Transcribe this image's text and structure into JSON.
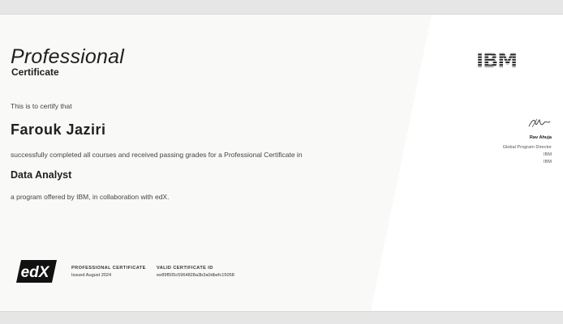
{
  "certificate": {
    "title": "Professional",
    "subtitle": "Certificate",
    "certify_text": "This is to certify that",
    "recipient_name": "Farouk Jaziri",
    "completion_text": "successfully completed all courses and received passing grades for a Professional Certificate in",
    "program_name": "Data Analyst",
    "offered_text": "a program offered by IBM, in collaboration with edX."
  },
  "footer": {
    "type_label": "PROFESSIONAL CERTIFICATE",
    "issued_text": "Issued August 2024",
    "id_label": "VALID CERTIFICATE ID",
    "certificate_id": "ee89f505c5964828a3b3a0dbefc15058"
  },
  "logos": {
    "edx": "edX",
    "ibm": "IBM"
  },
  "signatory": {
    "name": "Rav Ahuja",
    "role": "Global Program Director",
    "org1": "IBM",
    "org2": "IBM"
  },
  "colors": {
    "background": "#e6e6e6",
    "left_panel": "#f9f9f7",
    "text_dark": "#1f1f1f",
    "ibm_blue_black": "#1f1f1f"
  }
}
